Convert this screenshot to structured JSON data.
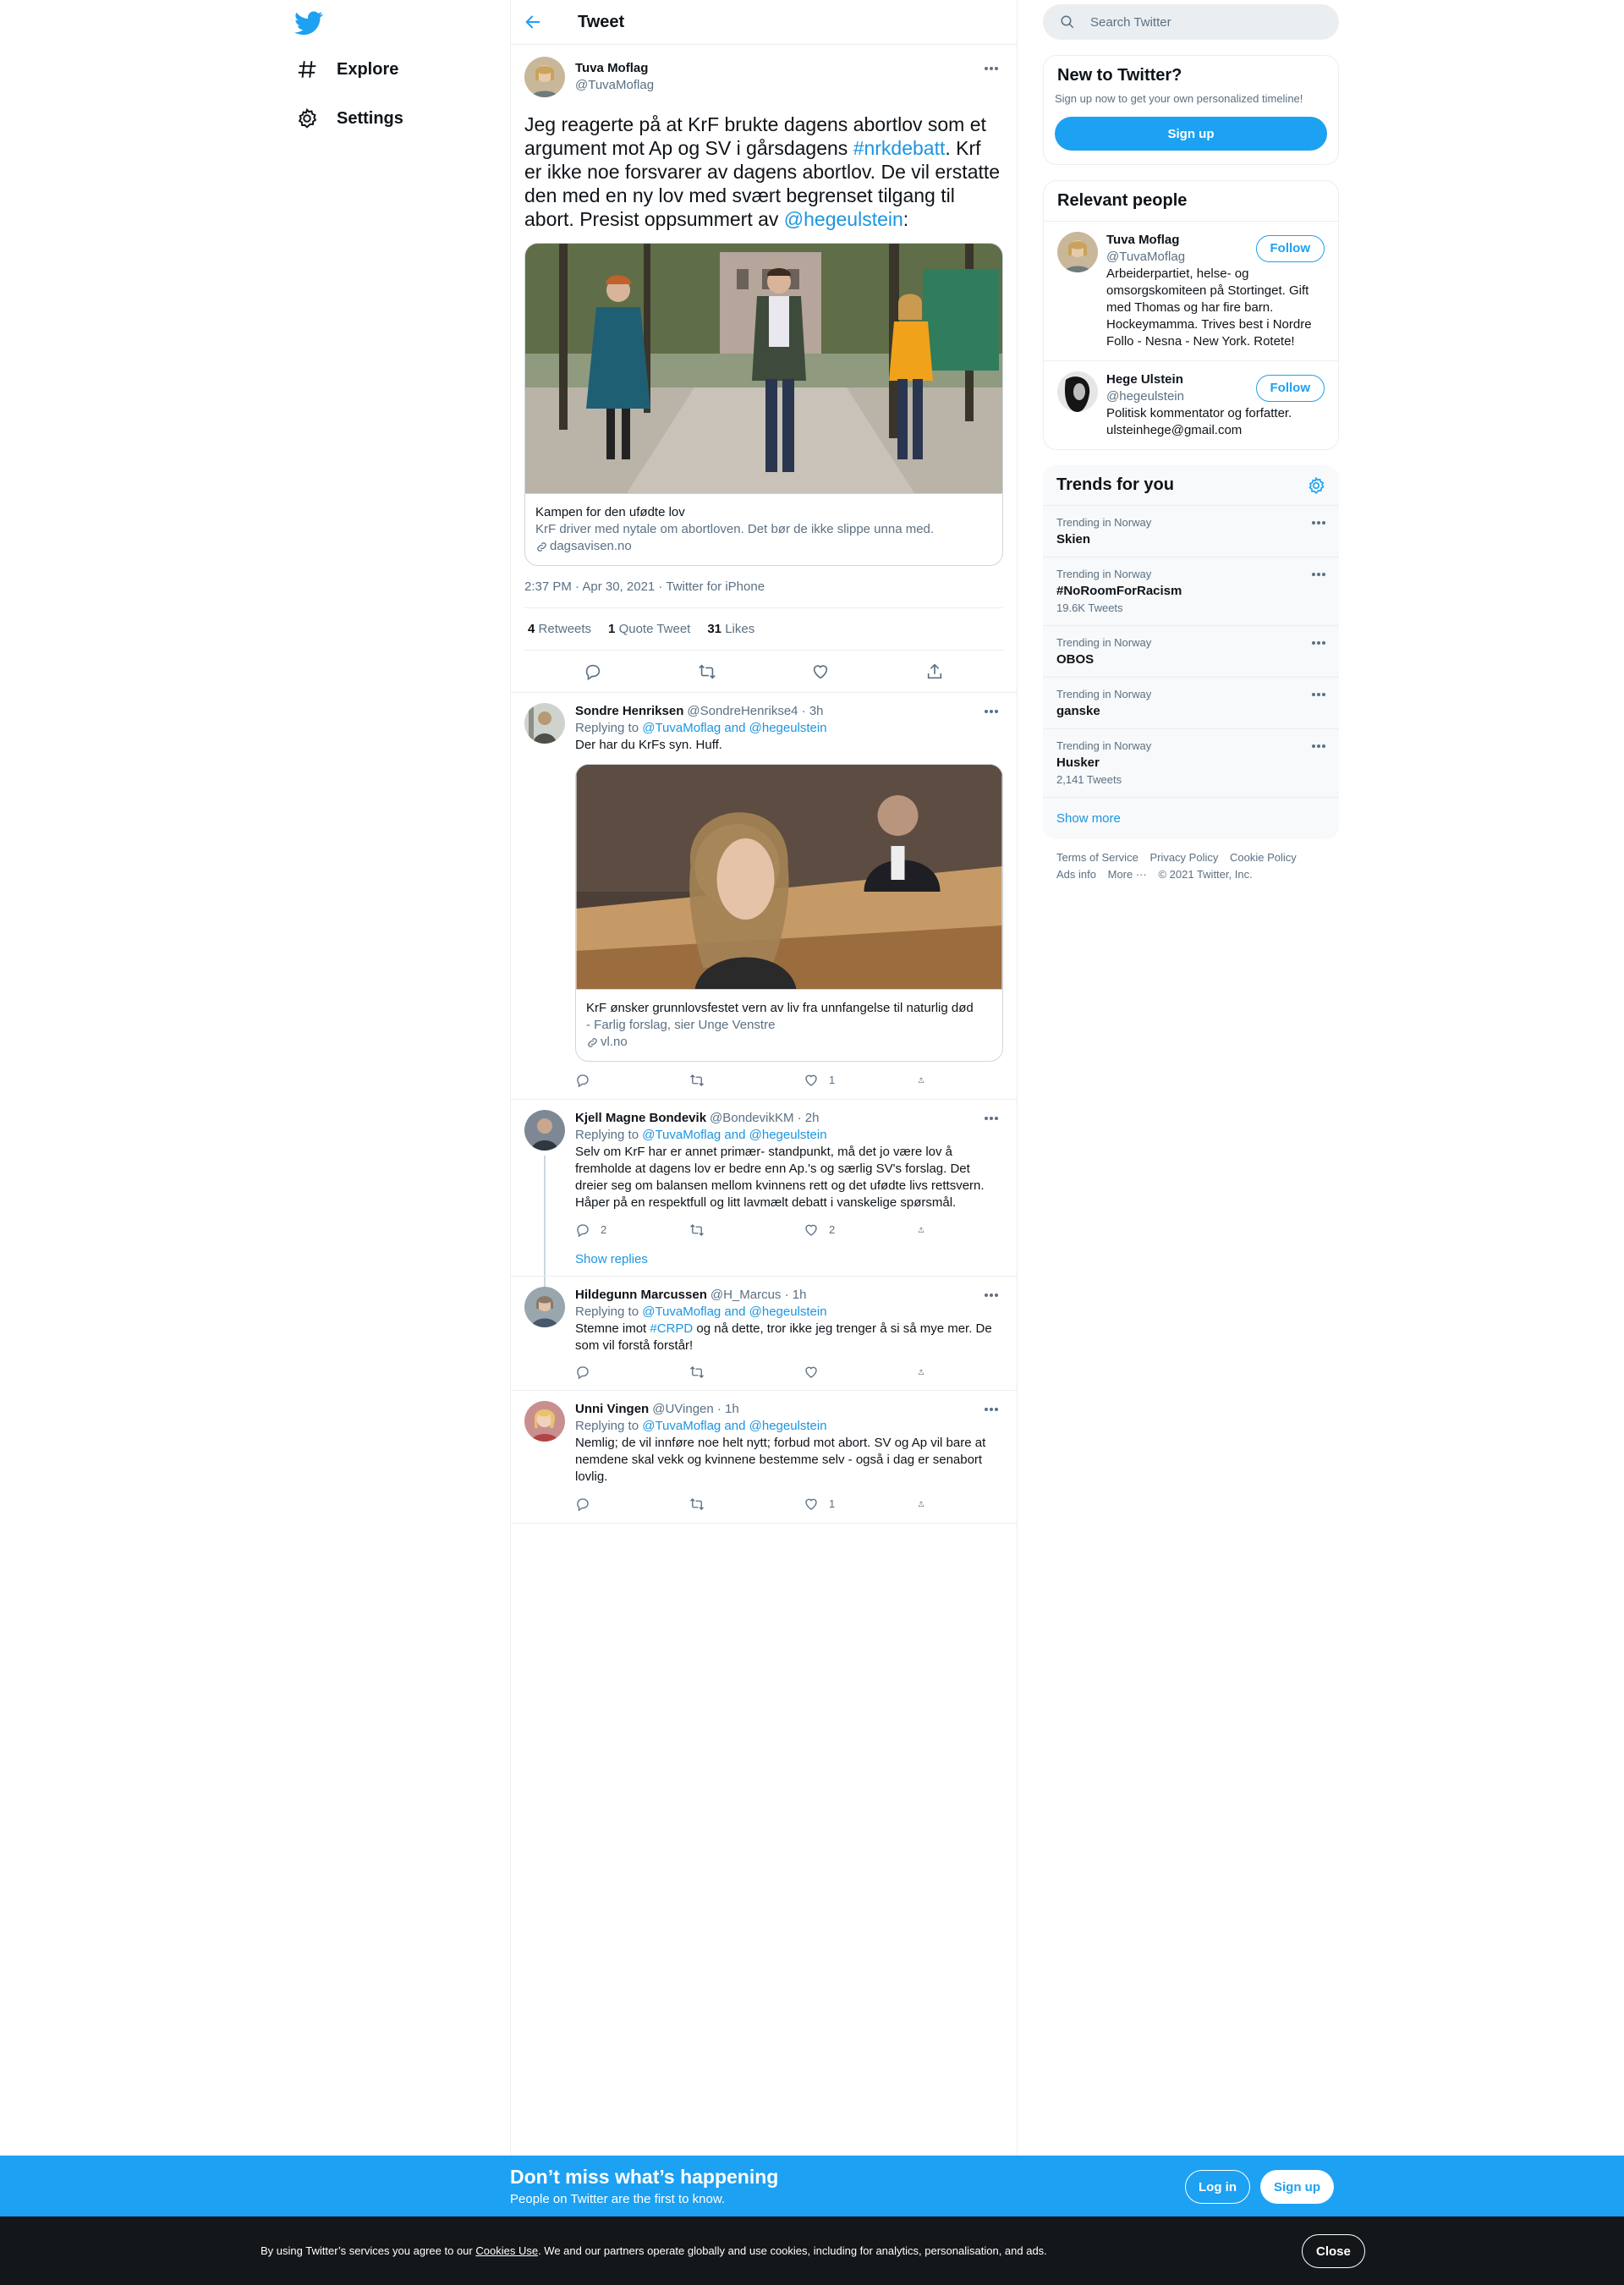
{
  "colors": {
    "accent": "#1da1f2",
    "link": "#1b95e0",
    "text": "#0f1419",
    "secondary": "#5b7083",
    "cookie_bg": "#14171a"
  },
  "nav": {
    "logo": "twitter-bird-icon",
    "items": [
      {
        "label": "Explore",
        "icon": "hashtag-icon"
      },
      {
        "label": "Settings",
        "icon": "gear-icon"
      }
    ]
  },
  "header": {
    "title": "Tweet",
    "back_icon": "back-arrow-icon"
  },
  "tweet": {
    "name": "Tuva Moflag",
    "handle": "@TuvaMoflag",
    "text_1": "Jeg reagerte på at KrF brukte dagens abortlov som et argument mot Ap og SV i gårsdagens ",
    "hashtag": "#nrkdebatt",
    "text_2": ". Krf er ikke noe forsvarer av dagens abortlov. De vil erstatte den med en ny lov med svært begrenset tilgang til abort. Presist oppsummert av ",
    "mention": "@hegeulstein",
    "text_3": ":",
    "card": {
      "title": "Kampen for den ufødte lov",
      "description": "KrF driver med nytale om abortloven. Det bør de ikke slippe unna med.",
      "domain": "dagsavisen.no"
    },
    "timestamp": "2:37 PM · Apr 30, 2021 · Twitter for iPhone",
    "stats": {
      "retweets_count": "4",
      "retweets_label": "Retweets",
      "quotes_count": "1",
      "quotes_label": "Quote Tweet",
      "likes_count": "31",
      "likes_label": "Likes"
    }
  },
  "replies": [
    {
      "name": "Sondre Henriksen",
      "handle": "@SondreHenrikse4 · 3h",
      "replying_label": "Replying to ",
      "replying_to": "@TuvaMoflag and @hegeulstein",
      "text": "Der har du KrFs syn. Huff.",
      "card": {
        "title": "KrF ønsker grunnlovsfestet vern av liv fra unnfangelse til naturlig død",
        "description": "- Farlig forslag, sier Unge Venstre",
        "domain": "vl.no"
      },
      "replies": "",
      "retweets": "",
      "likes": "1"
    },
    {
      "name": "Kjell Magne Bondevik",
      "handle": "@BondevikKM · 2h",
      "replying_label": "Replying to ",
      "replying_to": "@TuvaMoflag and @hegeulstein",
      "text": "Selv om KrF har er annet primær- standpunkt, må det jo være lov å fremholde at dagens lov er bedre enn Ap.'s og særlig SV's forslag. Det dreier seg om balansen mellom kvinnens rett og det ufødte livs rettsvern. Håper på en respektfull og litt lavmælt debatt i vanskelige spørsmål.",
      "replies": "2",
      "retweets": "",
      "likes": "2",
      "show_replies": "Show replies"
    },
    {
      "name": "Hildegunn Marcussen",
      "handle": "@H_Marcus · 1h",
      "replying_label": "Replying to ",
      "replying_to": "@TuvaMoflag and @hegeulstein",
      "text_1": "Stemne imot ",
      "hashtag": "#CRPD",
      "text_2": " og nå dette, tror ikke jeg trenger å si så mye mer. De som vil forstå forstår!",
      "replies": "",
      "retweets": "",
      "likes": ""
    },
    {
      "name": "Unni Vingen",
      "handle": "@UVingen · 1h",
      "replying_label": "Replying to ",
      "replying_to": "@TuvaMoflag and @hegeulstein",
      "text": "Nemlig; de vil innføre noe helt nytt; forbud mot abort. SV og Ap vil bare at nemdene skal vekk og kvinnene bestemme selv - også i dag er senabort lovlig.",
      "replies": "",
      "retweets": "",
      "likes": "1"
    }
  ],
  "search": {
    "placeholder": "Search Twitter"
  },
  "new_to_twitter": {
    "title": "New to Twitter?",
    "subtitle": "Sign up now to get your own personalized timeline!",
    "button": "Sign up"
  },
  "relevant_people": {
    "title": "Relevant people",
    "people": [
      {
        "name": "Tuva Moflag",
        "handle": "@TuvaMoflag",
        "bio": "Arbeiderpartiet, helse- og omsorgskomiteen på Stortinget. Gift med Thomas og har fire barn. Hockeymamma. Trives best i Nordre Follo - Nesna - New York. Rotete!",
        "button": "Follow"
      },
      {
        "name": "Hege Ulstein",
        "handle": "@hegeulstein",
        "bio": "Politisk kommentator og forfatter. ulsteinhege@gmail.com",
        "button": "Follow"
      }
    ]
  },
  "trends": {
    "title": "Trends for you",
    "items": [
      {
        "context": "Trending in Norway",
        "name": "Skien",
        "count": ""
      },
      {
        "context": "Trending in Norway",
        "name": "#NoRoomForRacism",
        "count": "19.6K Tweets"
      },
      {
        "context": "Trending in Norway",
        "name": "OBOS",
        "count": ""
      },
      {
        "context": "Trending in Norway",
        "name": "ganske",
        "count": ""
      },
      {
        "context": "Trending in Norway",
        "name": "Husker",
        "count": "2,141 Tweets"
      }
    ],
    "show_more": "Show more"
  },
  "footer": {
    "terms": "Terms of Service",
    "privacy": "Privacy Policy",
    "cookie": "Cookie Policy",
    "ads": "Ads info",
    "more": "More ···",
    "copyright": "© 2021 Twitter, Inc."
  },
  "bottom_bar": {
    "title": "Don’t miss what’s happening",
    "subtitle": "People on Twitter are the first to know.",
    "login": "Log in",
    "signup": "Sign up"
  },
  "cookie_bar": {
    "text_1": "By using Twitter’s services you agree to our ",
    "link": "Cookies Use",
    "text_2": ". We and our partners operate globally and use cookies, including for analytics, personalisation, and ads.",
    "close": "Close"
  }
}
